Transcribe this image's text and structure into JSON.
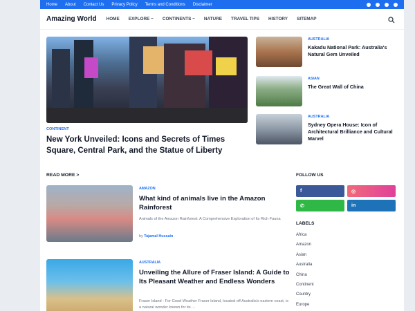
{
  "topbar": {
    "links": [
      "Home",
      "About",
      "Contact Us",
      "Privacy Policy",
      "Terms and Conditions",
      "Disclaimer"
    ]
  },
  "header": {
    "brand": "Amazing World",
    "nav": [
      "HOME",
      "EXPLORE ~",
      "CONTINENTS ~",
      "NATURE",
      "TRAVEL TIPS",
      "HISTORY",
      "SITEMAP"
    ]
  },
  "hero": {
    "category": "CONTINENT",
    "title": "New York Unveiled: Icons and Secrets of Times Square, Central Park, and the Statue of Liberty"
  },
  "side_stories": [
    {
      "category": "AUSTRALIA",
      "title": "Kakadu National Park: Australia's Natural Gem Unveiled"
    },
    {
      "category": "ASIAN",
      "title": "The Great Wall of China"
    },
    {
      "category": "AUSTRALIA",
      "title": "Sydney Opera House: Icon of Architectural Brilliance and Cultural Marvel"
    }
  ],
  "read_more": "READ MORE >",
  "articles": [
    {
      "category": "AMAZON",
      "title": "What kind of animals live in the Amazon Rainforest",
      "excerpt": "Animals of the Amazon Rainforest: A Comprehensive Exploration of Its Rich Fauna",
      "author_prefix": "by",
      "author": "Tajamal Hussain"
    },
    {
      "category": "AUSTRALIA",
      "title": "Unveiling the Allure of Fraser Island: A Guide to Its Pleasant Weather and Endless Wonders",
      "excerpt": "Fraser Island - For Good Weather Fraser Island, located off Australia's eastern coast, is a natural wonder known for its ..."
    }
  ],
  "sidebar": {
    "follow_heading": "FOLLOW US",
    "labels_heading": "LABELS",
    "labels": [
      "Africa",
      "Amazon",
      "Asian",
      "Australia",
      "China",
      "Continent",
      "Country",
      "Europe"
    ]
  },
  "colors": {
    "accent": "#1e6ff0",
    "facebook": "#3b5998",
    "whatsapp": "#2fb845",
    "linkedin": "#1e73b8"
  }
}
